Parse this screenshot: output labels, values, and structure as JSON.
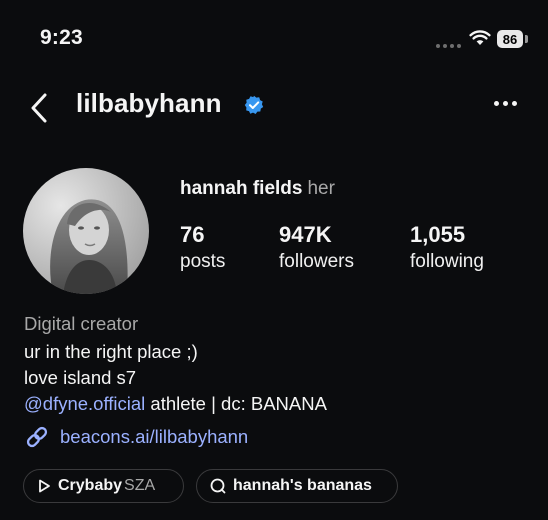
{
  "status_bar": {
    "time": "9:23",
    "battery": "86"
  },
  "header": {
    "username": "lilbabyhann"
  },
  "profile": {
    "full_name": "hannah fields",
    "pronouns": "her",
    "stats": [
      {
        "value": "76",
        "label": "posts"
      },
      {
        "value": "947K",
        "label": "followers"
      },
      {
        "value": "1,055",
        "label": "following"
      }
    ]
  },
  "bio": {
    "category": "Digital creator",
    "line1": "ur in the right place ;)",
    "line2": "love island s7",
    "mention": "@dfyne.official",
    "line3_rest": " athlete | dc: BANANA",
    "link": "beacons.ai/lilbabyhann"
  },
  "chips": [
    {
      "title": "Crybaby",
      "subtitle": "SZA"
    },
    {
      "title": "hannah's bananas"
    }
  ],
  "colors": {
    "background": "#0b0c0e",
    "link": "#9bb1ff",
    "verified": "#3897f0",
    "secondary_text": "#a8a8a8"
  }
}
